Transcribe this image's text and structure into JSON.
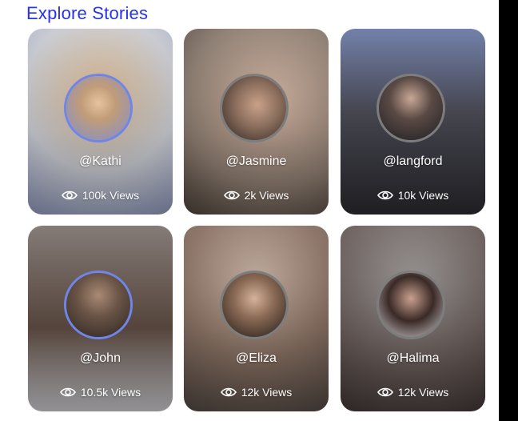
{
  "header": {
    "title": "Explore Stories"
  },
  "stories": [
    {
      "handle": "@Kathi",
      "views": "100k Views",
      "bg": [
        "#c9cbd2",
        "#b9a58a",
        "#8a94b8"
      ],
      "face": [
        "#d8b68c",
        "#a98a6d",
        "#5b6fb6"
      ],
      "ring": "blue"
    },
    {
      "handle": "@Jasmine",
      "views": "2k Views",
      "bg": [
        "#8c7c70",
        "#c7ab97",
        "#5a4d45"
      ],
      "face": [
        "#6b5648",
        "#c8a08a",
        "#2a221e"
      ],
      "ring": "grey"
    },
    {
      "handle": "@langford",
      "views": "10k Views",
      "bg": [
        "#6b7aa6",
        "#3f3f45",
        "#2a2a2f"
      ],
      "face": [
        "#4b4040",
        "#c9a795",
        "#1e1e22"
      ],
      "ring": "grey"
    },
    {
      "handle": "@John",
      "views": "10.5k Views",
      "bg": [
        "#7e7470",
        "#5e4c42",
        "#c9c8cd"
      ],
      "face": [
        "#6a5446",
        "#a98a75",
        "#2c2520"
      ],
      "ring": "blue"
    },
    {
      "handle": "@Eliza",
      "views": "12k Views",
      "bg": [
        "#a19890",
        "#6a5548",
        "#4e4540"
      ],
      "face": [
        "#8b6a55",
        "#d4b29b",
        "#1f1a18"
      ],
      "ring": "grey"
    },
    {
      "handle": "@Halima",
      "views": "12k Views",
      "bg": [
        "#8e8a88",
        "#5f5553",
        "#3f3533"
      ],
      "face": [
        "#cfcccf",
        "#3a2a27",
        "#1a1413"
      ],
      "ring": "grey"
    }
  ]
}
